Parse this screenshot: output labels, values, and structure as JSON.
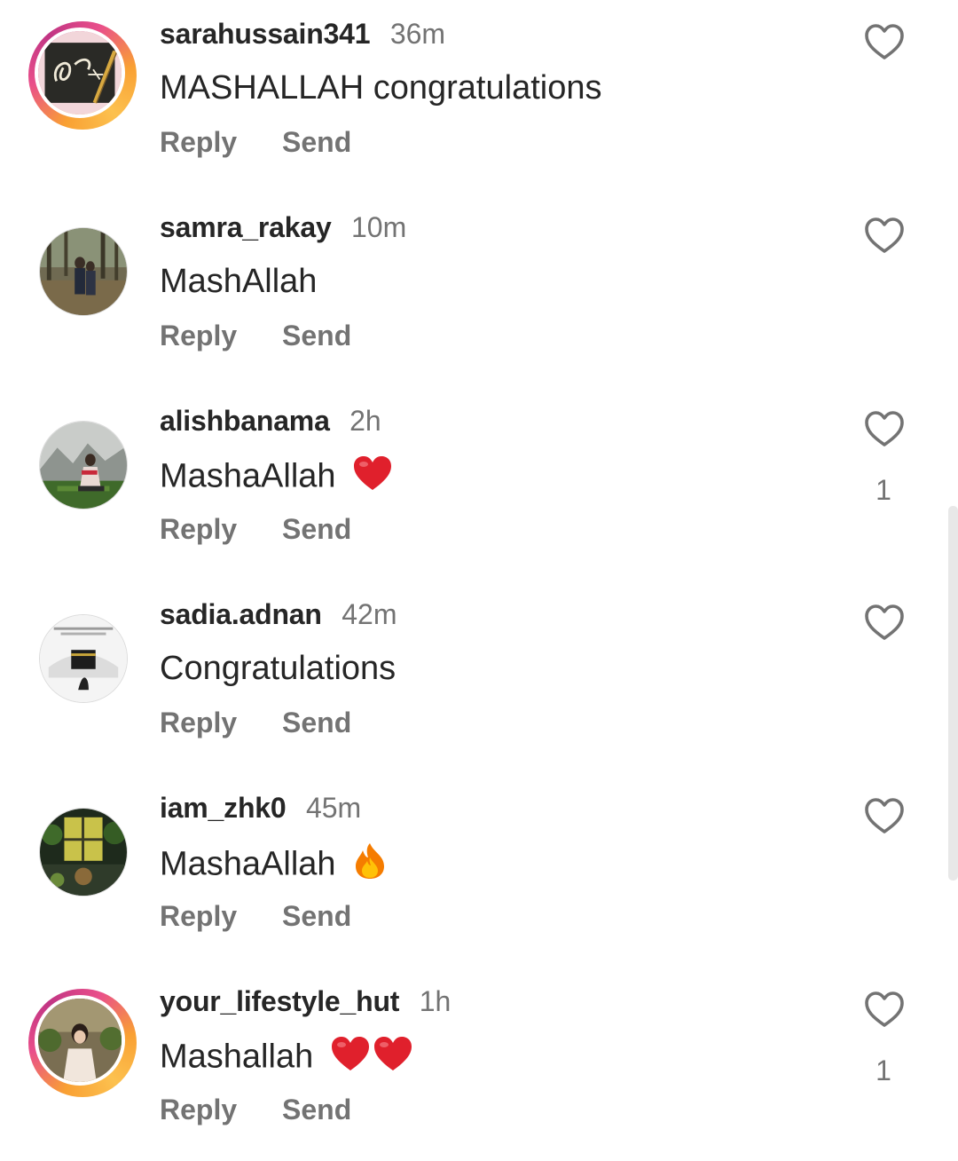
{
  "colors": {
    "text": "#262626",
    "muted": "#737373",
    "heart_red": "#e0202c",
    "story_ring": "#e94f8a"
  },
  "comments": [
    {
      "username": "sarahussain341",
      "time": "36m",
      "text": "MASHALLAH congratulations",
      "emoji": "",
      "likes": "",
      "reply": "Reply",
      "send": "Send",
      "story": true
    },
    {
      "username": "samra_rakay",
      "time": "10m",
      "text": "MashAllah",
      "emoji": "",
      "likes": "",
      "reply": "Reply",
      "send": "Send",
      "story": false
    },
    {
      "username": "alishbanama",
      "time": "2h",
      "text": "MashaAllah",
      "emoji": "red-heart",
      "likes": "1",
      "reply": "Reply",
      "send": "Send",
      "story": false
    },
    {
      "username": "sadia.adnan",
      "time": "42m",
      "text": "Congratulations",
      "emoji": "",
      "likes": "",
      "reply": "Reply",
      "send": "Send",
      "story": false
    },
    {
      "username": "iam_zhk0",
      "time": "45m",
      "text": "MashaAllah",
      "emoji": "fire",
      "likes": "",
      "reply": "Reply",
      "send": "Send",
      "story": false
    },
    {
      "username": "your_lifestyle_hut",
      "time": "1h",
      "text": "Mashallah",
      "emoji": "two-red-hearts",
      "likes": "1",
      "reply": "Reply",
      "send": "Send",
      "story": true
    }
  ]
}
